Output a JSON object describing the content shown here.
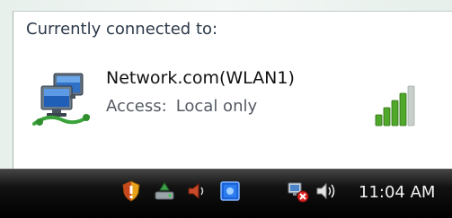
{
  "flyout": {
    "header": "Currently connected to:",
    "network": {
      "name": "Network.com(WLAN1)",
      "access_label": "Access:",
      "access_value": "Local only",
      "signal_level": 0.8,
      "icon": "network-computers-icon"
    }
  },
  "taskbar": {
    "tray_icons": [
      "security-shield-icon",
      "safely-remove-hardware-icon",
      "speaker-icon",
      "blue-app-icon",
      "network-disconnected-icon",
      "volume-icon"
    ],
    "clock": "11:04 AM"
  },
  "colors": {
    "signal_green": "#4fa82a",
    "signal_empty": "#c8cfcb",
    "taskbar": "#000000"
  }
}
